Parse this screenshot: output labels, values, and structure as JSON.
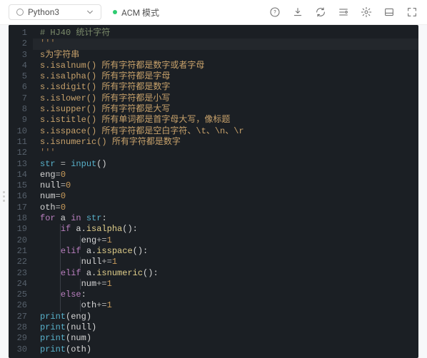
{
  "header": {
    "language": "Python3",
    "mode_label": "ACM 模式"
  },
  "toolbar": {
    "help": "help-icon",
    "download": "download-icon",
    "refresh": "refresh-icon",
    "settings_lines": "settings-lines-icon",
    "gear": "gear-icon",
    "panel": "panel-icon",
    "fullscreen": "fullscreen-icon"
  },
  "editor": {
    "lines": [
      {
        "n": 1,
        "tokens": [
          {
            "t": "# HJ40 统计字符",
            "c": "c-comment"
          }
        ]
      },
      {
        "n": 2,
        "active": true,
        "tokens": [
          {
            "t": "'''",
            "c": "c-tstr"
          }
        ]
      },
      {
        "n": 3,
        "tokens": [
          {
            "t": "s为字符串",
            "c": "c-str"
          }
        ]
      },
      {
        "n": 4,
        "tokens": [
          {
            "t": "s.isalnum() 所有字符都是数字或者字母",
            "c": "c-str"
          }
        ]
      },
      {
        "n": 5,
        "tokens": [
          {
            "t": "s.isalpha() 所有字符都是字母",
            "c": "c-str"
          }
        ]
      },
      {
        "n": 6,
        "tokens": [
          {
            "t": "s.isdigit() 所有字符都是数字",
            "c": "c-str"
          }
        ]
      },
      {
        "n": 7,
        "tokens": [
          {
            "t": "s.islower() 所有字符都是小写",
            "c": "c-str"
          }
        ]
      },
      {
        "n": 8,
        "tokens": [
          {
            "t": "s.isupper() 所有字符都是大写",
            "c": "c-str"
          }
        ]
      },
      {
        "n": 9,
        "tokens": [
          {
            "t": "s.istitle() 所有单词都是首字母大写，像标题",
            "c": "c-str"
          }
        ]
      },
      {
        "n": 10,
        "tokens": [
          {
            "t": "s.isspace() 所有字符都是空白字符、\\t、\\n、\\r",
            "c": "c-str"
          }
        ]
      },
      {
        "n": 11,
        "tokens": [
          {
            "t": "s.isnumeric() 所有字符都是数字",
            "c": "c-str"
          }
        ]
      },
      {
        "n": 12,
        "tokens": [
          {
            "t": "'''",
            "c": "c-tstr"
          }
        ]
      },
      {
        "n": 13,
        "tokens": [
          {
            "t": "str",
            "c": "c-func"
          },
          {
            "t": " = ",
            "c": "c-op"
          },
          {
            "t": "input",
            "c": "c-func"
          },
          {
            "t": "()",
            "c": "c-ident"
          }
        ]
      },
      {
        "n": 14,
        "tokens": [
          {
            "t": "eng",
            "c": "c-ident"
          },
          {
            "t": "=",
            "c": "c-op"
          },
          {
            "t": "0",
            "c": "c-num"
          }
        ]
      },
      {
        "n": 15,
        "tokens": [
          {
            "t": "null",
            "c": "c-ident"
          },
          {
            "t": "=",
            "c": "c-op"
          },
          {
            "t": "0",
            "c": "c-num"
          }
        ]
      },
      {
        "n": 16,
        "tokens": [
          {
            "t": "num",
            "c": "c-ident"
          },
          {
            "t": "=",
            "c": "c-op"
          },
          {
            "t": "0",
            "c": "c-num"
          }
        ]
      },
      {
        "n": 17,
        "tokens": [
          {
            "t": "oth",
            "c": "c-ident"
          },
          {
            "t": "=",
            "c": "c-op"
          },
          {
            "t": "0",
            "c": "c-num"
          }
        ]
      },
      {
        "n": 18,
        "tokens": [
          {
            "t": "for",
            "c": "c-kw"
          },
          {
            "t": " a ",
            "c": "c-ident"
          },
          {
            "t": "in",
            "c": "c-kw"
          },
          {
            "t": " ",
            "c": ""
          },
          {
            "t": "str",
            "c": "c-func"
          },
          {
            "t": ":",
            "c": "c-ident"
          }
        ]
      },
      {
        "n": 19,
        "indent": 1,
        "guides": [
          28
        ],
        "tokens": [
          {
            "t": "    ",
            "c": ""
          },
          {
            "t": "if",
            "c": "c-kw"
          },
          {
            "t": " a.",
            "c": "c-ident"
          },
          {
            "t": "isalpha",
            "c": "c-call"
          },
          {
            "t": "():",
            "c": "c-ident"
          }
        ]
      },
      {
        "n": 20,
        "indent": 2,
        "guides": [
          28,
          56
        ],
        "tokens": [
          {
            "t": "        eng",
            "c": "c-ident"
          },
          {
            "t": "+=",
            "c": "c-op"
          },
          {
            "t": "1",
            "c": "c-num"
          }
        ]
      },
      {
        "n": 21,
        "indent": 1,
        "guides": [
          28
        ],
        "tokens": [
          {
            "t": "    ",
            "c": ""
          },
          {
            "t": "elif",
            "c": "c-kw"
          },
          {
            "t": " a.",
            "c": "c-ident"
          },
          {
            "t": "isspace",
            "c": "c-call"
          },
          {
            "t": "():",
            "c": "c-ident"
          }
        ]
      },
      {
        "n": 22,
        "indent": 2,
        "guides": [
          28,
          56
        ],
        "tokens": [
          {
            "t": "        null",
            "c": "c-ident"
          },
          {
            "t": "+=",
            "c": "c-op"
          },
          {
            "t": "1",
            "c": "c-num"
          }
        ]
      },
      {
        "n": 23,
        "indent": 1,
        "guides": [
          28
        ],
        "tokens": [
          {
            "t": "    ",
            "c": ""
          },
          {
            "t": "elif",
            "c": "c-kw"
          },
          {
            "t": " a.",
            "c": "c-ident"
          },
          {
            "t": "isnumeric",
            "c": "c-call"
          },
          {
            "t": "():",
            "c": "c-ident"
          }
        ]
      },
      {
        "n": 24,
        "indent": 2,
        "guides": [
          28,
          56
        ],
        "tokens": [
          {
            "t": "        num",
            "c": "c-ident"
          },
          {
            "t": "+=",
            "c": "c-op"
          },
          {
            "t": "1",
            "c": "c-num"
          }
        ]
      },
      {
        "n": 25,
        "indent": 1,
        "guides": [
          28
        ],
        "tokens": [
          {
            "t": "    ",
            "c": ""
          },
          {
            "t": "else",
            "c": "c-kw"
          },
          {
            "t": ":",
            "c": "c-ident"
          }
        ]
      },
      {
        "n": 26,
        "indent": 2,
        "guides": [
          28,
          56
        ],
        "tokens": [
          {
            "t": "        oth",
            "c": "c-ident"
          },
          {
            "t": "+=",
            "c": "c-op"
          },
          {
            "t": "1",
            "c": "c-num"
          }
        ]
      },
      {
        "n": 27,
        "tokens": [
          {
            "t": "print",
            "c": "c-func"
          },
          {
            "t": "(eng)",
            "c": "c-ident"
          }
        ]
      },
      {
        "n": 28,
        "tokens": [
          {
            "t": "print",
            "c": "c-func"
          },
          {
            "t": "(null)",
            "c": "c-ident"
          }
        ]
      },
      {
        "n": 29,
        "tokens": [
          {
            "t": "print",
            "c": "c-func"
          },
          {
            "t": "(num)",
            "c": "c-ident"
          }
        ]
      },
      {
        "n": 30,
        "tokens": [
          {
            "t": "print",
            "c": "c-func"
          },
          {
            "t": "(oth)",
            "c": "c-ident"
          }
        ]
      }
    ]
  }
}
